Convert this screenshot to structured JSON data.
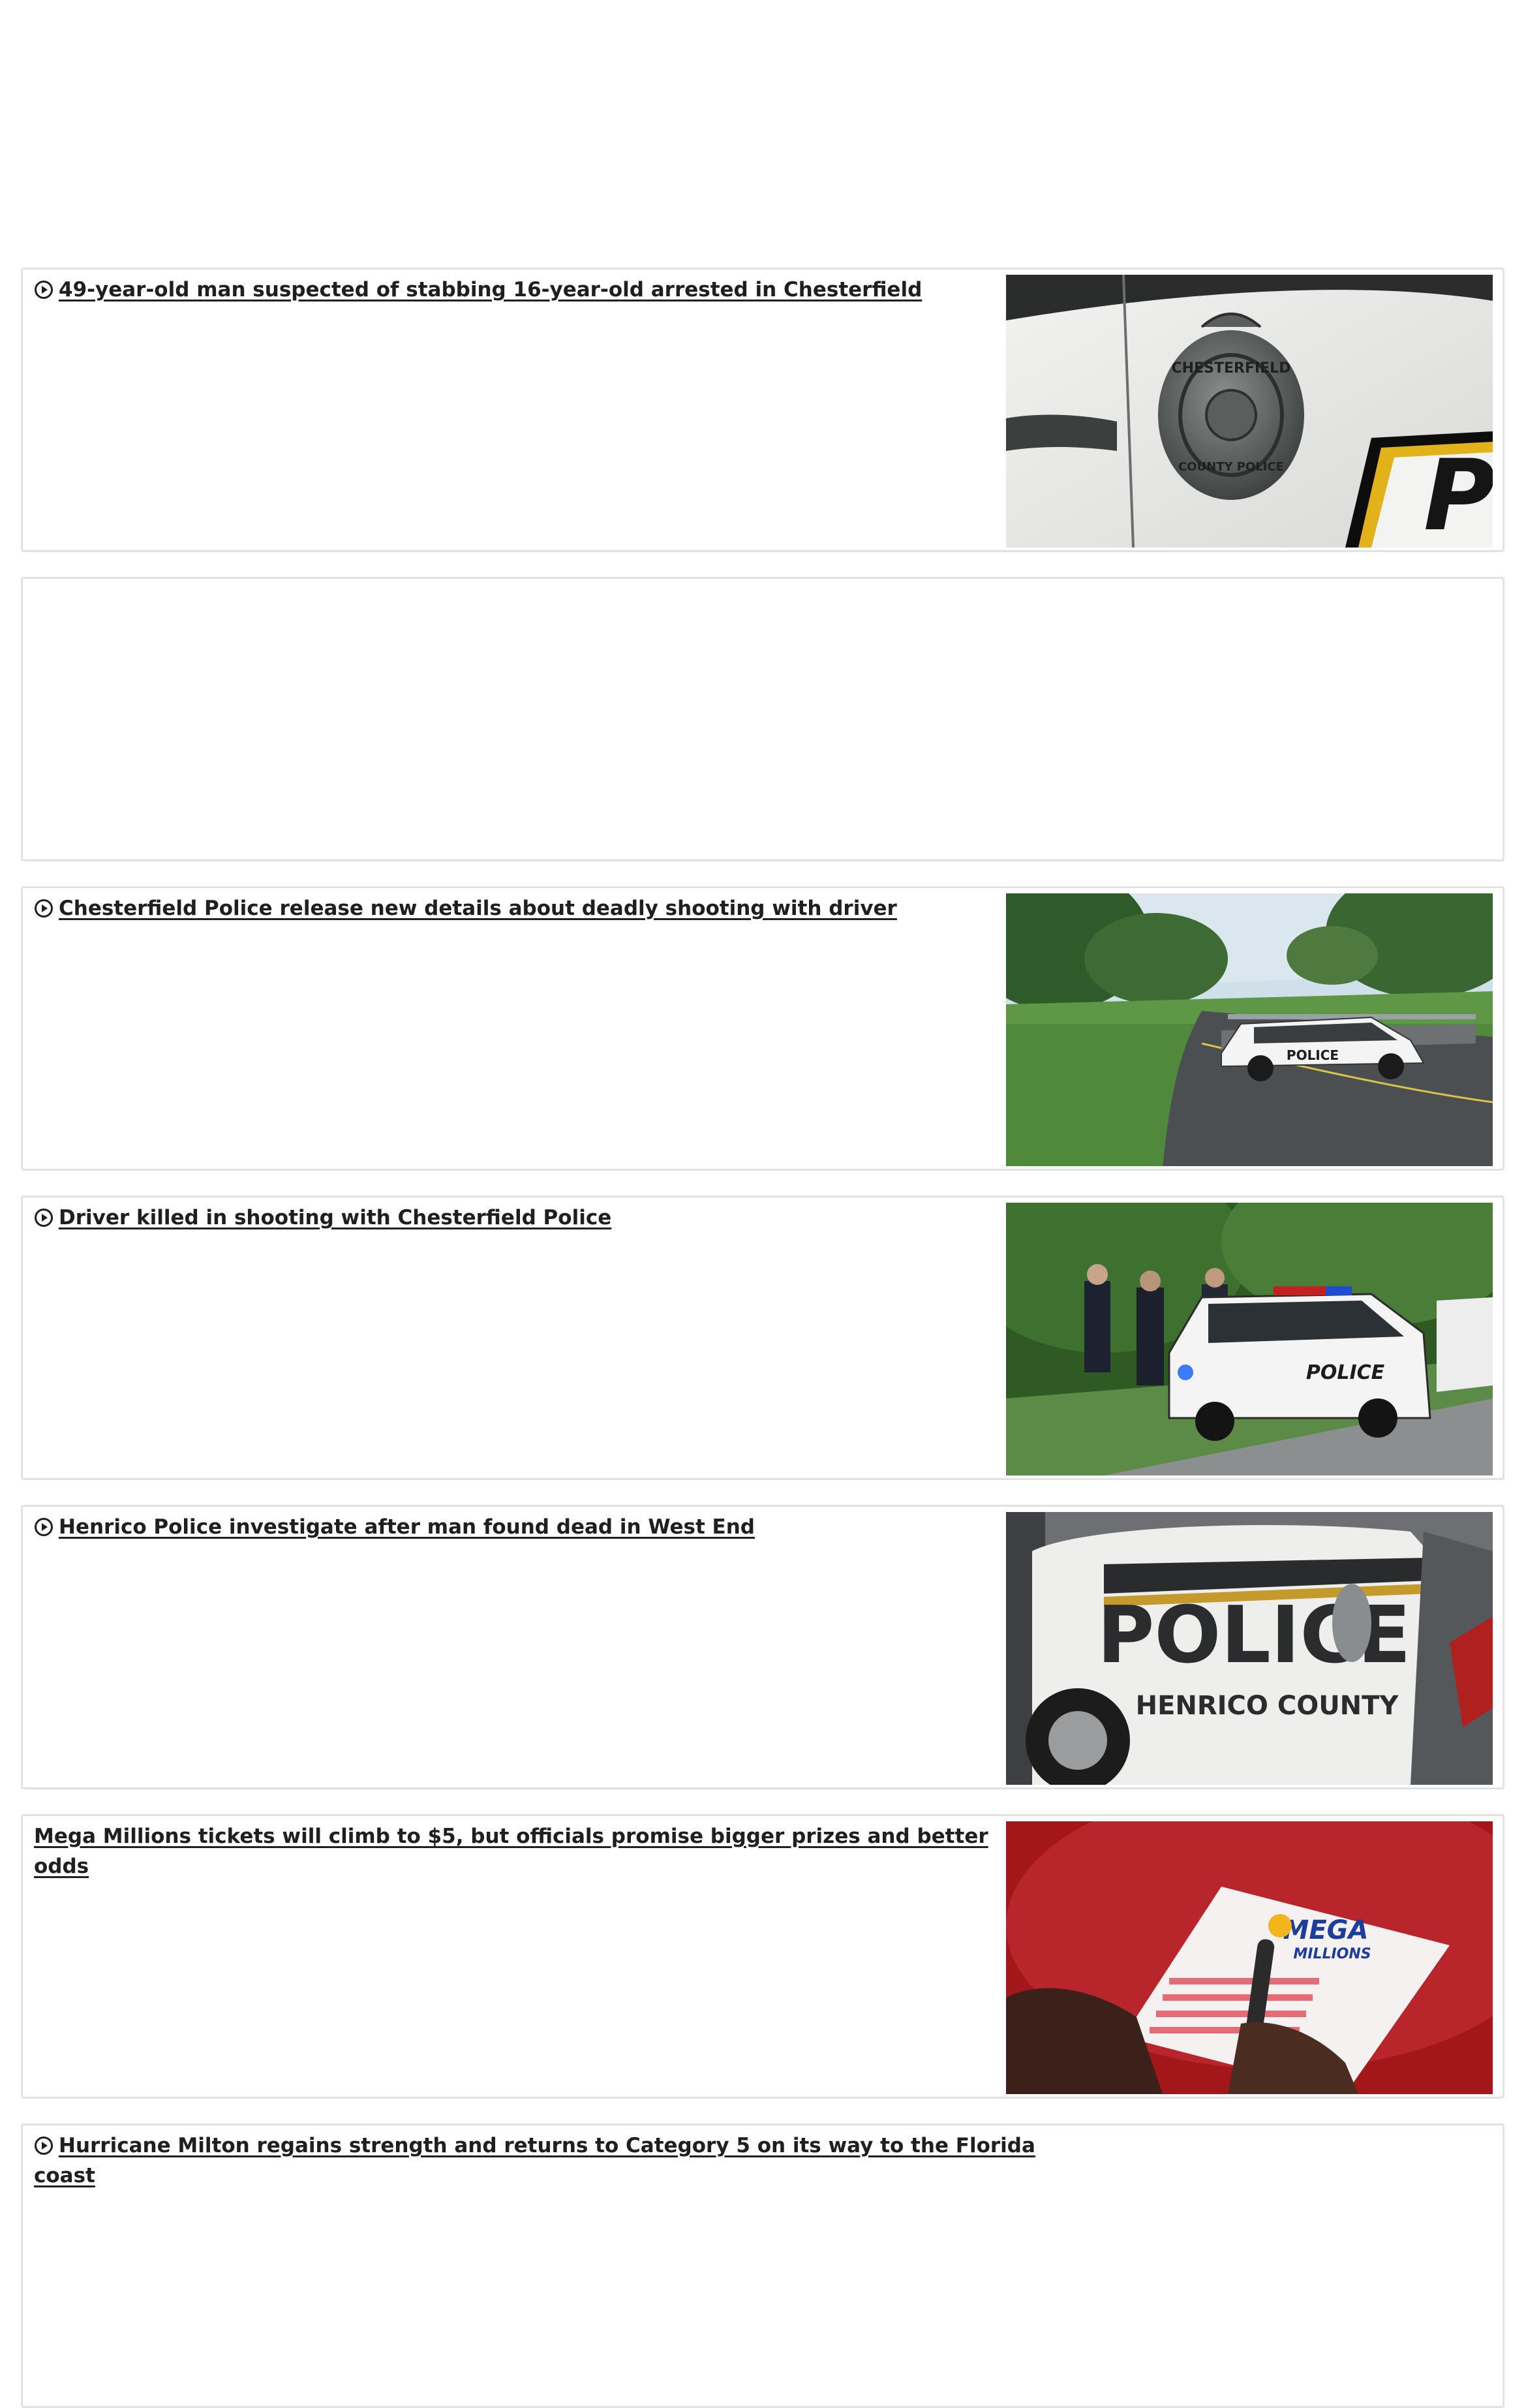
{
  "stories": [
    {
      "headline": "49-year-old man suspected of stabbing 16-year-old arrested in Chesterfield",
      "has_video": true,
      "thumb_icon": "police-badge-car-door-image"
    },
    {
      "headline": "",
      "has_video": false,
      "thumb_icon": ""
    },
    {
      "headline": "Chesterfield Police release new details about deadly shooting with driver",
      "has_video": true,
      "thumb_icon": "police-car-road-image"
    },
    {
      "headline": "Driver killed in shooting with Chesterfield Police",
      "has_video": true,
      "thumb_icon": "officers-police-suv-image"
    },
    {
      "headline": "Henrico Police investigate after man found dead in West End",
      "has_video": true,
      "thumb_icon": "henrico-police-car-image"
    },
    {
      "headline": "Mega Millions tickets will climb to $5, but officials promise bigger prizes and better odds",
      "has_video": false,
      "thumb_icon": "mega-millions-ticket-image",
      "thumb_text": "MEGA MILLIONS"
    },
    {
      "headline": "Hurricane Milton regains strength and returns to Category 5 on its way to the Florida coast",
      "has_video": true,
      "thumb_icon": ""
    }
  ],
  "thumb_texts": {
    "car_door_p": "P",
    "badge_top": "CHESTERFIELD",
    "badge_bottom": "COUNTY POLICE",
    "car_label": "POLICE",
    "suv_label": "POLICE",
    "henrico_big": "POLICE",
    "henrico_county": "HENRICO COUNTY",
    "mega_top": "MEGA",
    "mega_bottom": "MILLIONS"
  },
  "colors": {
    "card_border": "#e2e2e2",
    "headline": "#1f1f1f",
    "mega_red": "#b0191e"
  }
}
